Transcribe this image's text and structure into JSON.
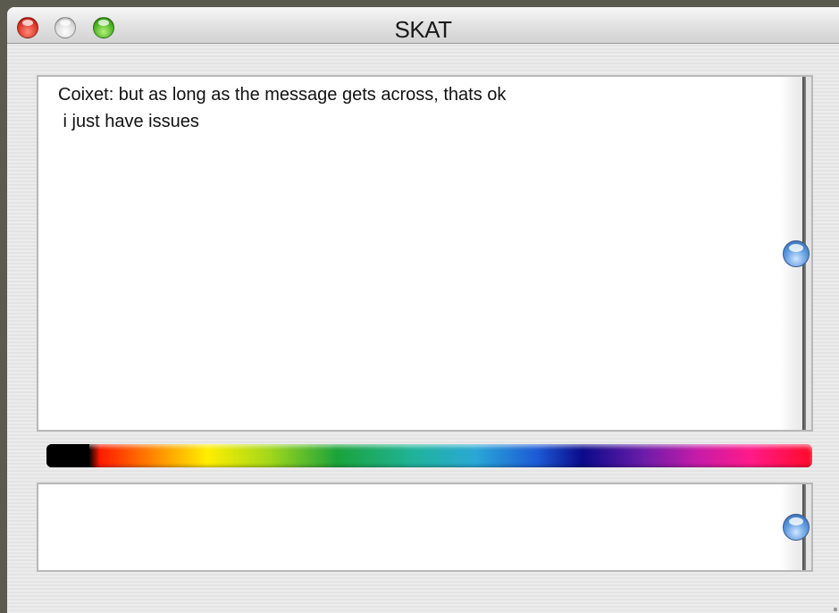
{
  "window": {
    "title": "SKAT"
  },
  "chat": {
    "lines": [
      "Coixet: but as long as the message gets across, thats ok",
      " i just have issues"
    ],
    "scroll_position": 0.5
  },
  "color_picker": {
    "selected_color": "#000000",
    "gradient_colors": [
      "#000000",
      "#ff1a00",
      "#ff8800",
      "#ffee00",
      "#a4d81a",
      "#1ba33b",
      "#20b39a",
      "#2aa8d6",
      "#1d5bd6",
      "#0a0a8a",
      "#6b1ca8",
      "#c51ca8",
      "#ff1a88",
      "#ff0a2a"
    ]
  },
  "input": {
    "value": "",
    "scroll_position": 0.5
  },
  "icons": {
    "close": "close-icon",
    "minimize": "minimize-icon",
    "zoom": "zoom-icon",
    "scroll_thumb": "scroll-thumb-icon"
  }
}
